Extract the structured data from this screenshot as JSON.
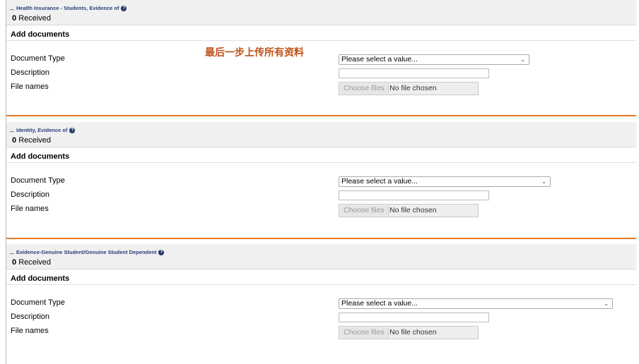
{
  "sections": [
    {
      "toggle": "_",
      "title": "Health Insurance - Students, Evidence of",
      "received_count": "0",
      "received_label": "Received",
      "add_documents": "Add documents",
      "labels": {
        "doc_type": "Document Type",
        "description": "Description",
        "file_names": "File names"
      },
      "select_value": "Please select a value...",
      "choose_files": "Choose files",
      "no_file": "No file chosen"
    },
    {
      "toggle": "_",
      "title": "Identity, Evidence of",
      "received_count": "0",
      "received_label": "Received",
      "add_documents": "Add documents",
      "labels": {
        "doc_type": "Document Type",
        "description": "Description",
        "file_names": "File names"
      },
      "select_value": "Please select a value...",
      "choose_files": "Choose files",
      "no_file": "No file chosen"
    },
    {
      "toggle": "_",
      "title": "Evidence-Genuine Student/Genuine Student Dependent",
      "received_count": "0",
      "received_label": "Received",
      "add_documents": "Add documents",
      "labels": {
        "doc_type": "Document Type",
        "description": "Description",
        "file_names": "File names"
      },
      "select_value": "Please select a value...",
      "choose_files": "Choose files",
      "no_file": "No file chosen"
    }
  ],
  "annotation": "最后一步上传所有资料",
  "icons": {
    "help": "help-icon",
    "select_arrow": "chevron-down-icon"
  },
  "colors": {
    "separator": "#e87722",
    "title": "#2a3f7a",
    "annotation": "#c0521a",
    "header_bg": "#f0f0f0"
  }
}
